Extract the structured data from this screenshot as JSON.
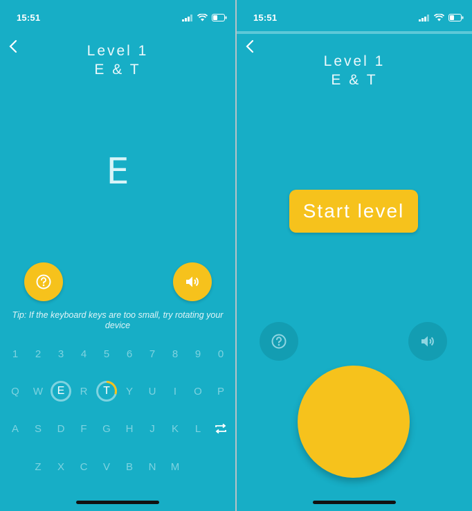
{
  "left": {
    "status": {
      "time": "15:51"
    },
    "title_line1": "Level 1",
    "title_line2": "E & T",
    "current_letter": "E",
    "tip": "Tip: If the keyboard keys are too small, try rotating your device",
    "keyboard": {
      "numbers": [
        "1",
        "2",
        "3",
        "4",
        "5",
        "6",
        "7",
        "8",
        "9",
        "0"
      ],
      "row1": [
        "Q",
        "W",
        "E",
        "R",
        "T",
        "Y",
        "U",
        "I",
        "O",
        "P"
      ],
      "row2": [
        "A",
        "S",
        "D",
        "F",
        "G",
        "H",
        "J",
        "K",
        "L"
      ],
      "row3": [
        "Z",
        "X",
        "C",
        "V",
        "B",
        "N",
        "M"
      ],
      "active_key": "E",
      "partial_key": "T",
      "partial_progress": 0.3
    }
  },
  "right": {
    "status": {
      "time": "15:51"
    },
    "title_line1": "Level 1",
    "title_line2": "E & T",
    "start_label": "Start level"
  },
  "colors": {
    "background": "#17aec6",
    "accent": "#f6c21c",
    "key_text": "#7fd3e0"
  },
  "icons": [
    "back-chevron-icon",
    "help-icon",
    "speaker-icon",
    "swap-icon",
    "signal-icon",
    "wifi-icon",
    "battery-icon"
  ]
}
